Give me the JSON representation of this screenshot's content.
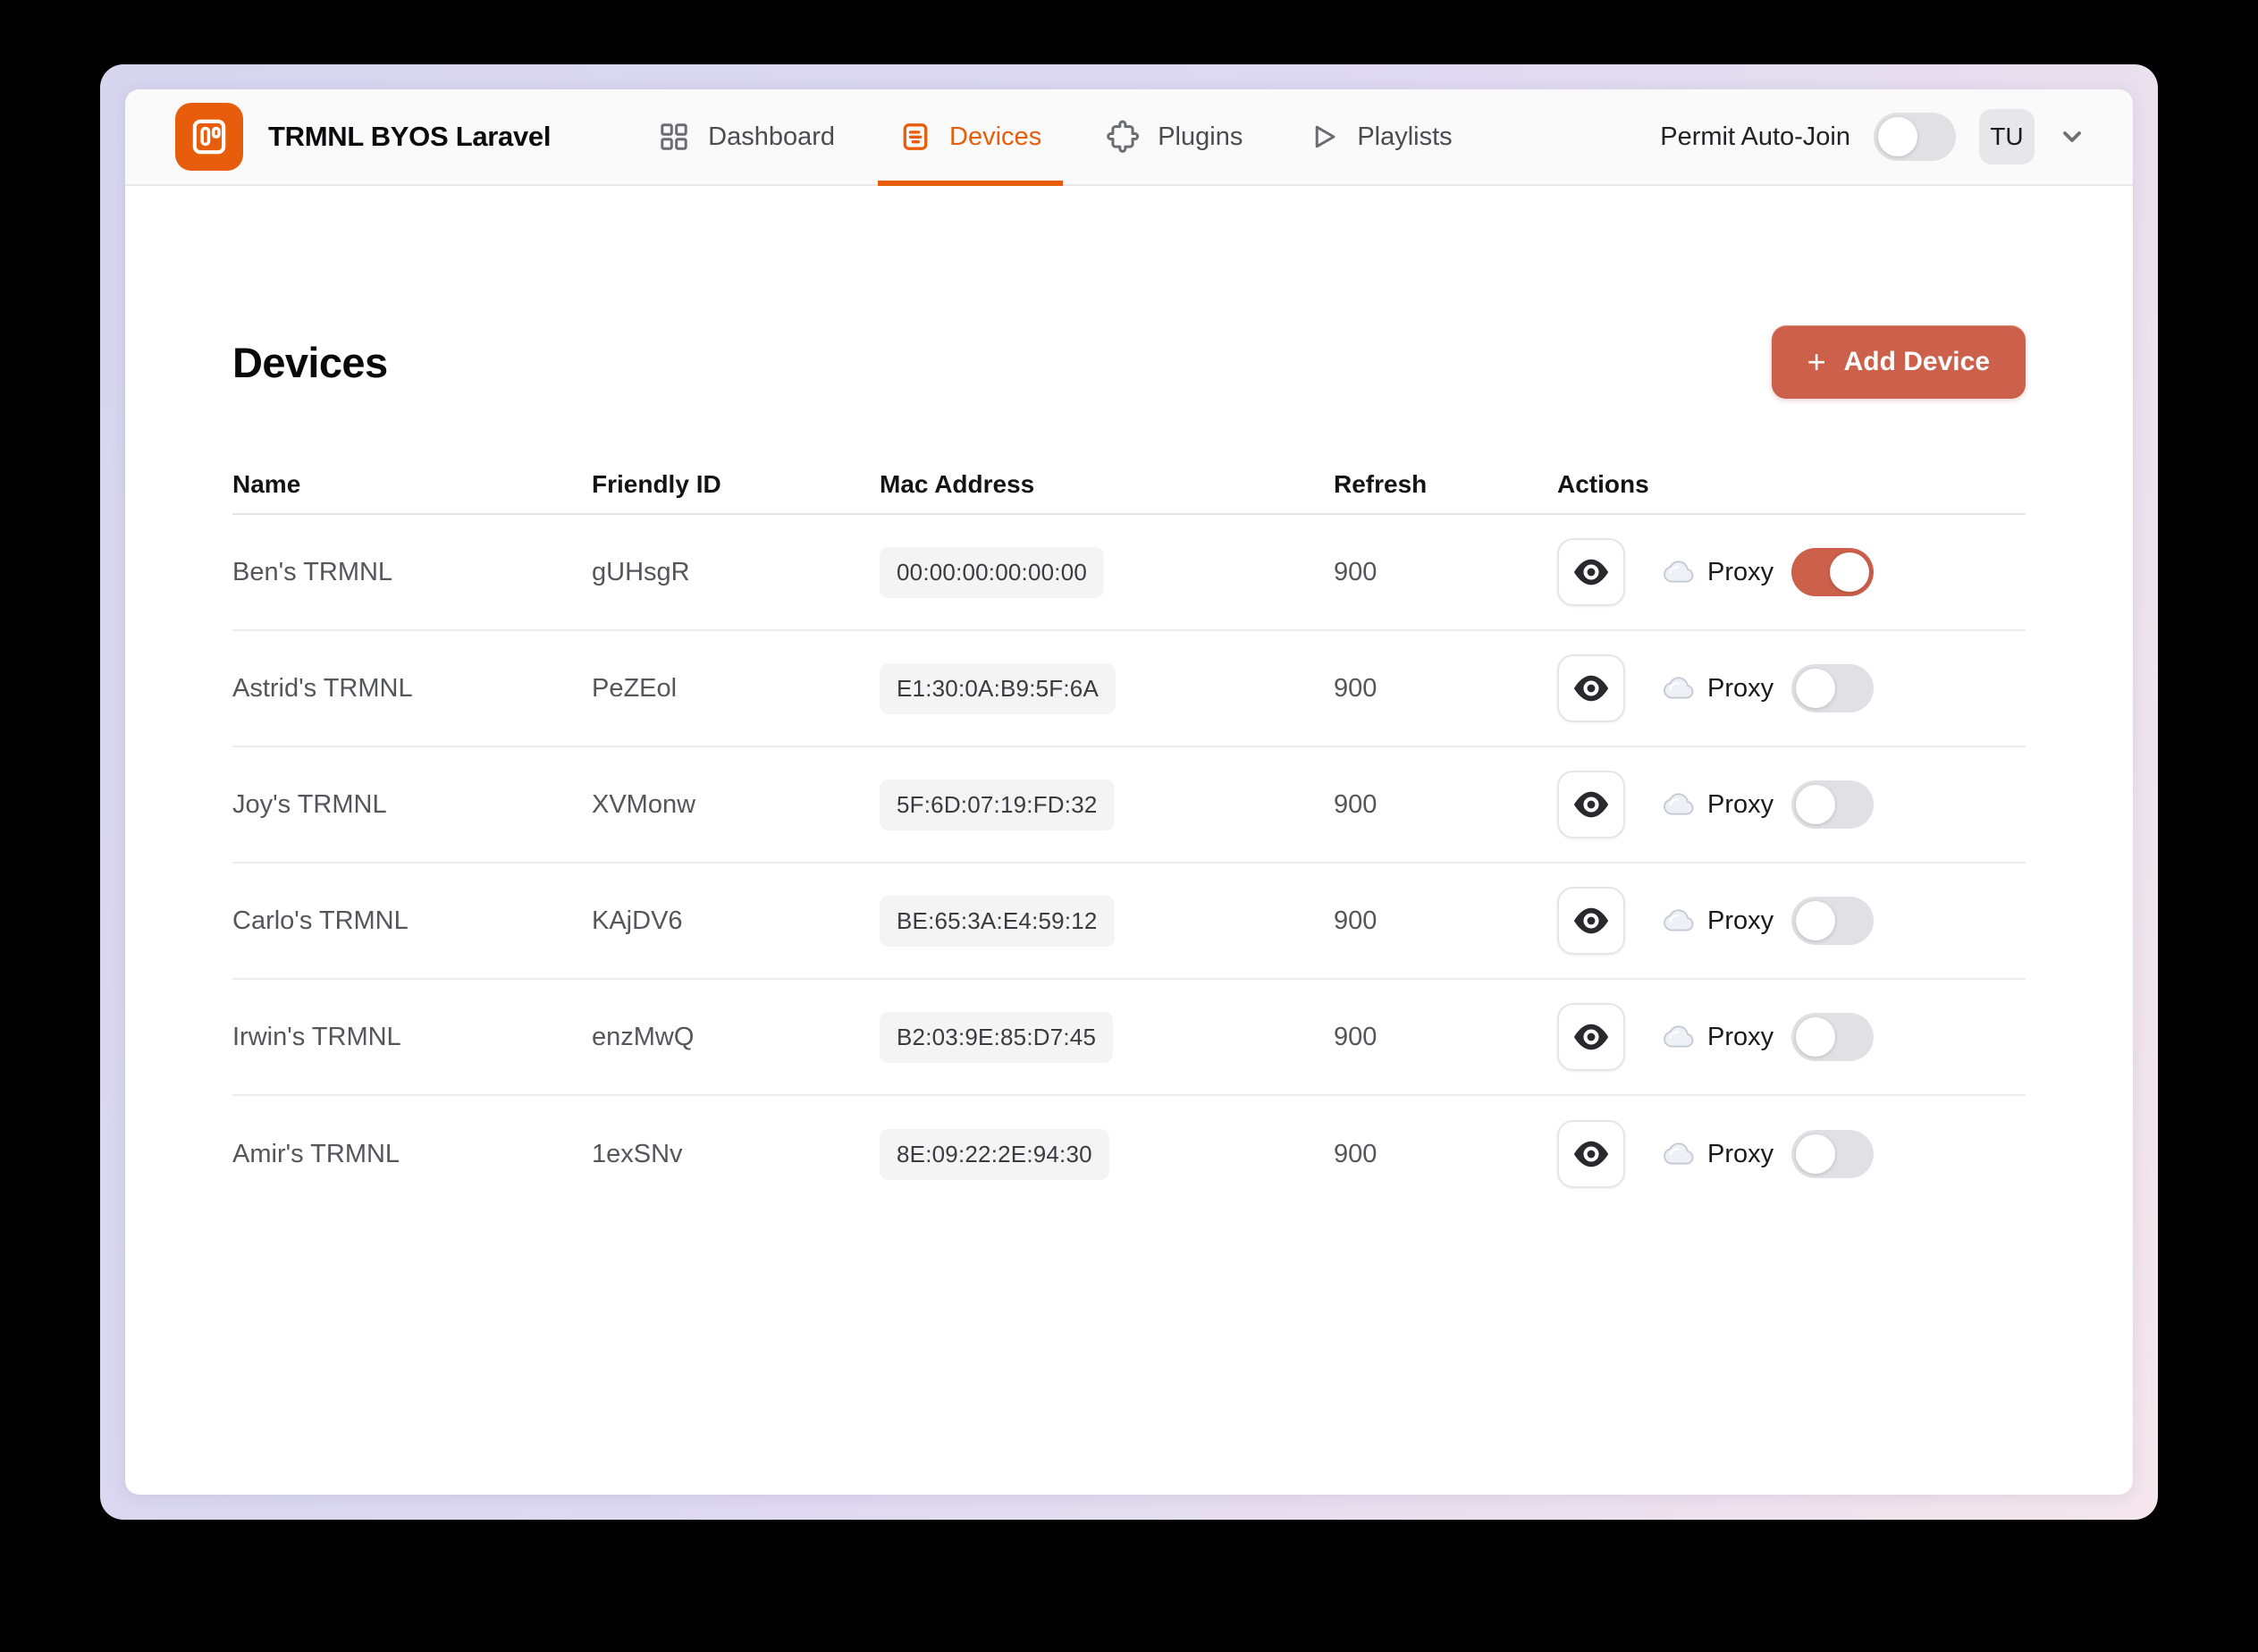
{
  "colors": {
    "brand_orange": "#E85D0C",
    "accent_coral": "#CC604B",
    "header_bg": "#FAFAFA",
    "window_border_from": "#D8D5EF",
    "window_border_to": "#F4E6EC",
    "badge_bg": "#F4F4F5",
    "toggle_off": "#E1E1E5",
    "text_dark": "#18181B",
    "text_gray": "#55555C",
    "nav_gray": "#4B4B52"
  },
  "header": {
    "brand": "TRMNL BYOS Laravel",
    "nav": {
      "dashboard": "Dashboard",
      "devices": "Devices",
      "plugins": "Plugins",
      "playlists": "Playlists"
    },
    "permit_auto_join": {
      "label": "Permit Auto-Join",
      "on": false
    },
    "avatar": "TU"
  },
  "main": {
    "title": "Devices",
    "add_device": {
      "plus": "+",
      "label": "Add Device"
    },
    "table": {
      "columns": [
        "Name",
        "Friendly ID",
        "Mac Address",
        "Refresh",
        "Actions"
      ],
      "rows": [
        {
          "name": "Ben's TRMNL",
          "friendly_id": "gUHsgR",
          "mac": "00:00:00:00:00:00",
          "refresh": "900",
          "proxy_label": "Proxy",
          "proxy_on": true
        },
        {
          "name": "Astrid's TRMNL",
          "friendly_id": "PeZEol",
          "mac": "E1:30:0A:B9:5F:6A",
          "refresh": "900",
          "proxy_label": "Proxy",
          "proxy_on": false
        },
        {
          "name": "Joy's TRMNL",
          "friendly_id": "XVMonw",
          "mac": "5F:6D:07:19:FD:32",
          "refresh": "900",
          "proxy_label": "Proxy",
          "proxy_on": false
        },
        {
          "name": "Carlo's TRMNL",
          "friendly_id": "KAjDV6",
          "mac": "BE:65:3A:E4:59:12",
          "refresh": "900",
          "proxy_label": "Proxy",
          "proxy_on": false
        },
        {
          "name": "Irwin's TRMNL",
          "friendly_id": "enzMwQ",
          "mac": "B2:03:9E:85:D7:45",
          "refresh": "900",
          "proxy_label": "Proxy",
          "proxy_on": false
        },
        {
          "name": "Amir's TRMNL",
          "friendly_id": "1exSNv",
          "mac": "8E:09:22:2E:94:30",
          "refresh": "900",
          "proxy_label": "Proxy",
          "proxy_on": false
        }
      ]
    }
  }
}
